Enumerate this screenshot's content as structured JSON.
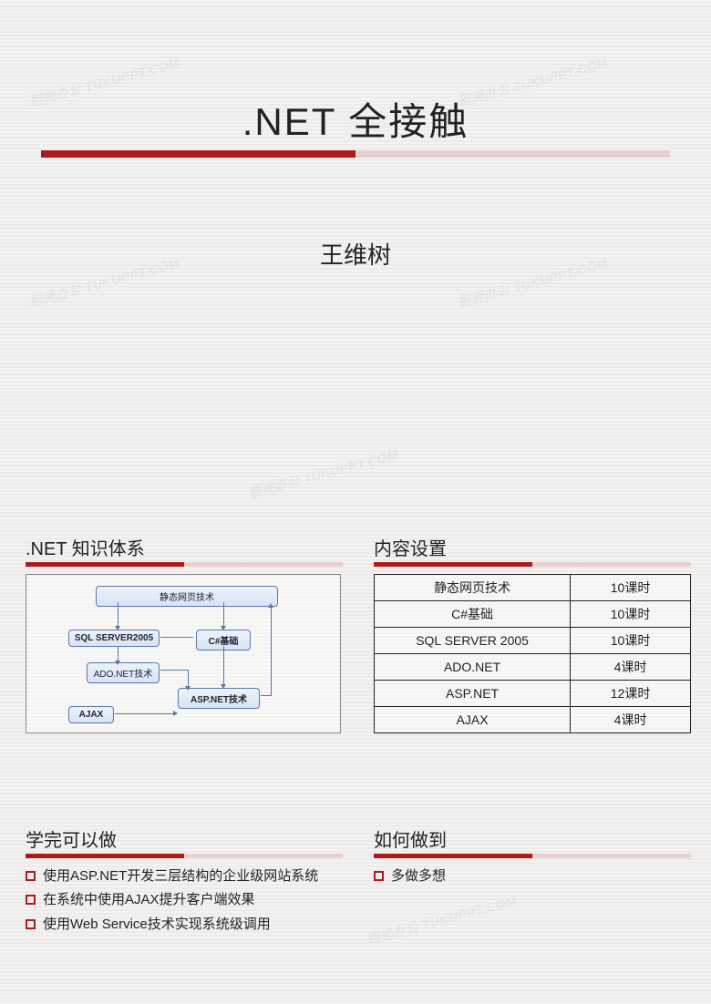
{
  "watermark_text": "稻壳办公 TUKUPPT.COM",
  "slide1": {
    "title": ".NET 全接触",
    "author": "王维树"
  },
  "knowledge": {
    "heading": ".NET 知识体系",
    "nodes": {
      "static_web": "静态网页技术",
      "sql": "SQL SERVER2005",
      "csharp": "C#基础",
      "ado": "ADO.NET技术",
      "asp": "ASP.NET技术",
      "ajax": "AJAX"
    }
  },
  "content": {
    "heading": "内容设置",
    "rows": [
      {
        "name": "静态网页技术",
        "hours": "10课时"
      },
      {
        "name": "C#基础",
        "hours": "10课时"
      },
      {
        "name": "SQL SERVER 2005",
        "hours": "10课时"
      },
      {
        "name": "ADO.NET",
        "hours": "4课时"
      },
      {
        "name": "ASP.NET",
        "hours": "12课时"
      },
      {
        "name": "AJAX",
        "hours": "4课时"
      }
    ]
  },
  "cando": {
    "heading": "学完可以做",
    "items": [
      "使用ASP.NET开发三层结构的企业级网站系统",
      "在系统中使用AJAX提升客户端效果",
      "使用Web Service技术实现系统级调用"
    ]
  },
  "howto": {
    "heading": "如何做到",
    "items": [
      "多做多想"
    ]
  }
}
